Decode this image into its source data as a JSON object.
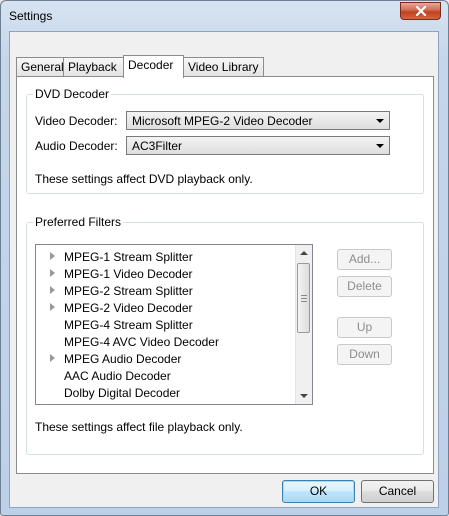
{
  "window": {
    "title": "Settings"
  },
  "tabs": [
    {
      "label": "General"
    },
    {
      "label": "Playback"
    },
    {
      "label": "Decoder",
      "active": true
    },
    {
      "label": "Video Library"
    }
  ],
  "dvd_decoder": {
    "group_label": "DVD Decoder",
    "video_label": "Video Decoder:",
    "video_value": "Microsoft MPEG-2 Video Decoder",
    "audio_label": "Audio Decoder:",
    "audio_value": "AC3Filter",
    "note": "These settings affect DVD playback only."
  },
  "preferred_filters": {
    "group_label": "Preferred Filters",
    "items": [
      {
        "label": "MPEG-1 Stream Splitter",
        "expandable": true
      },
      {
        "label": "MPEG-1 Video Decoder",
        "expandable": true
      },
      {
        "label": "MPEG-2 Stream Splitter",
        "expandable": true
      },
      {
        "label": "MPEG-2 Video Decoder",
        "expandable": true
      },
      {
        "label": "MPEG-4 Stream Splitter",
        "expandable": false
      },
      {
        "label": "MPEG-4 AVC Video Decoder",
        "expandable": false
      },
      {
        "label": "MPEG Audio Decoder",
        "expandable": true
      },
      {
        "label": "AAC Audio Decoder",
        "expandable": false
      },
      {
        "label": "Dolby Digital Decoder",
        "expandable": false
      }
    ],
    "buttons": {
      "add": "Add...",
      "delete": "Delete",
      "up": "Up",
      "down": "Down"
    },
    "note": "These settings affect file playback only."
  },
  "footer": {
    "ok": "OK",
    "cancel": "Cancel"
  },
  "colors": {
    "close_button": "#c74a2a",
    "default_button_border": "#3c7fb1"
  }
}
